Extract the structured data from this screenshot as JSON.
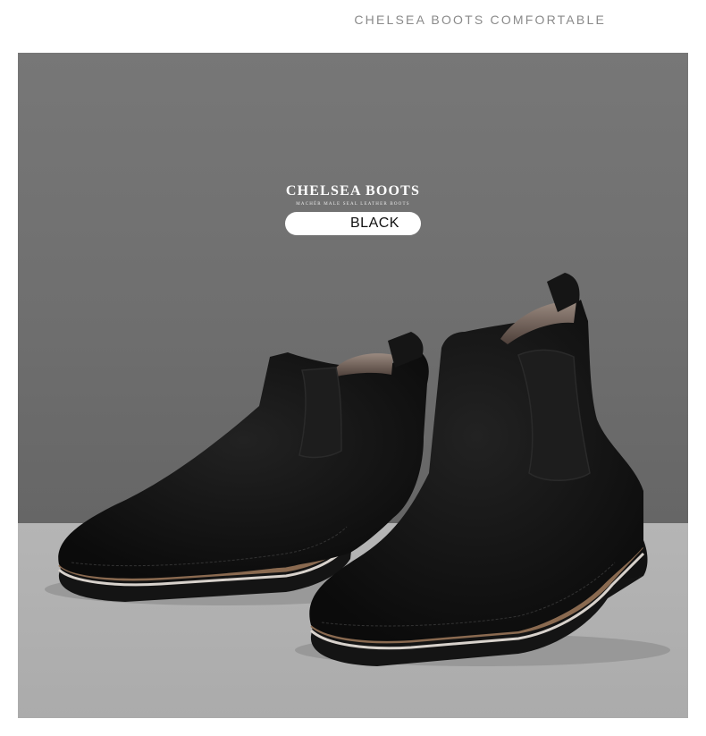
{
  "heading": "CHELSEA BOOTS COMFORTABLE",
  "product": {
    "title": "CHELSEA BOOTS",
    "subtitle": "MACHÉR MALE SEAL LEATHER BOOTS",
    "color": "BLACK"
  },
  "photo": {
    "subject": "pair of black suede chelsea boots",
    "colors": {
      "backdrop_top": "#777777",
      "backdrop_bottom": "#b0b0b0",
      "suede": "#111111",
      "elastic": "#1c1c1c",
      "welt": "#8a6a50",
      "fur": "#6a5a52"
    }
  }
}
